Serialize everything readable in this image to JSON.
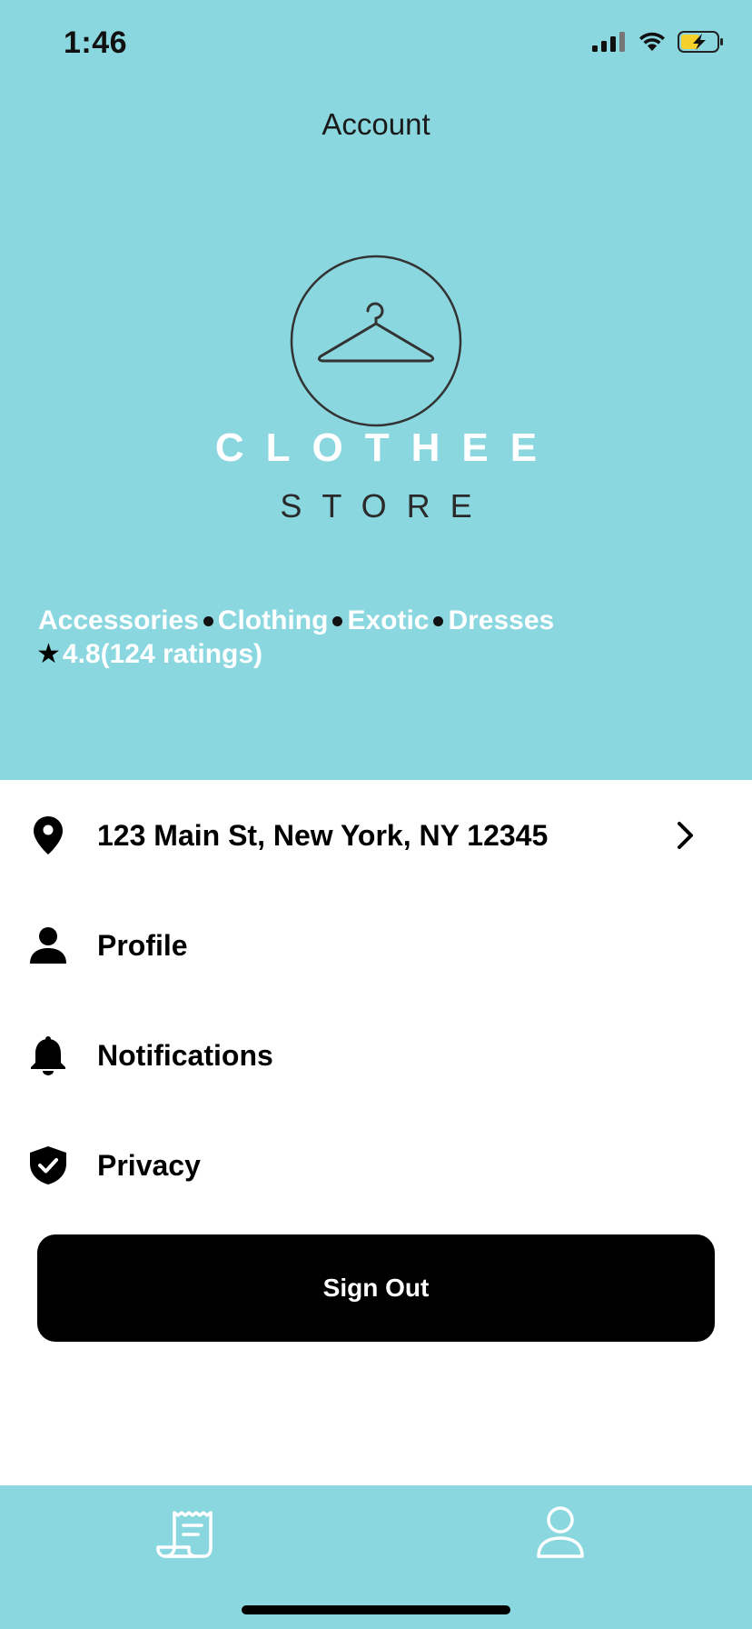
{
  "status_bar": {
    "time": "1:46"
  },
  "header": {
    "title": "Account",
    "brand_name": "CLOTHEE",
    "brand_sub": "STORE",
    "categories": [
      "Accessories",
      "Clothing",
      "Exotic",
      "Dresses"
    ],
    "rating_value": "4.8",
    "rating_count": "(124 ratings)"
  },
  "menu": {
    "address": "123 Main St, New York, NY 12345",
    "profile": "Profile",
    "notifications": "Notifications",
    "privacy": "Privacy"
  },
  "signout_label": "Sign Out",
  "tabs": [
    {
      "icon": "receipt-icon"
    },
    {
      "icon": "person-icon"
    }
  ],
  "colors": {
    "header_bg": "#8AD7E0",
    "button_bg": "#000000",
    "battery_fill": "#F5D02A"
  }
}
